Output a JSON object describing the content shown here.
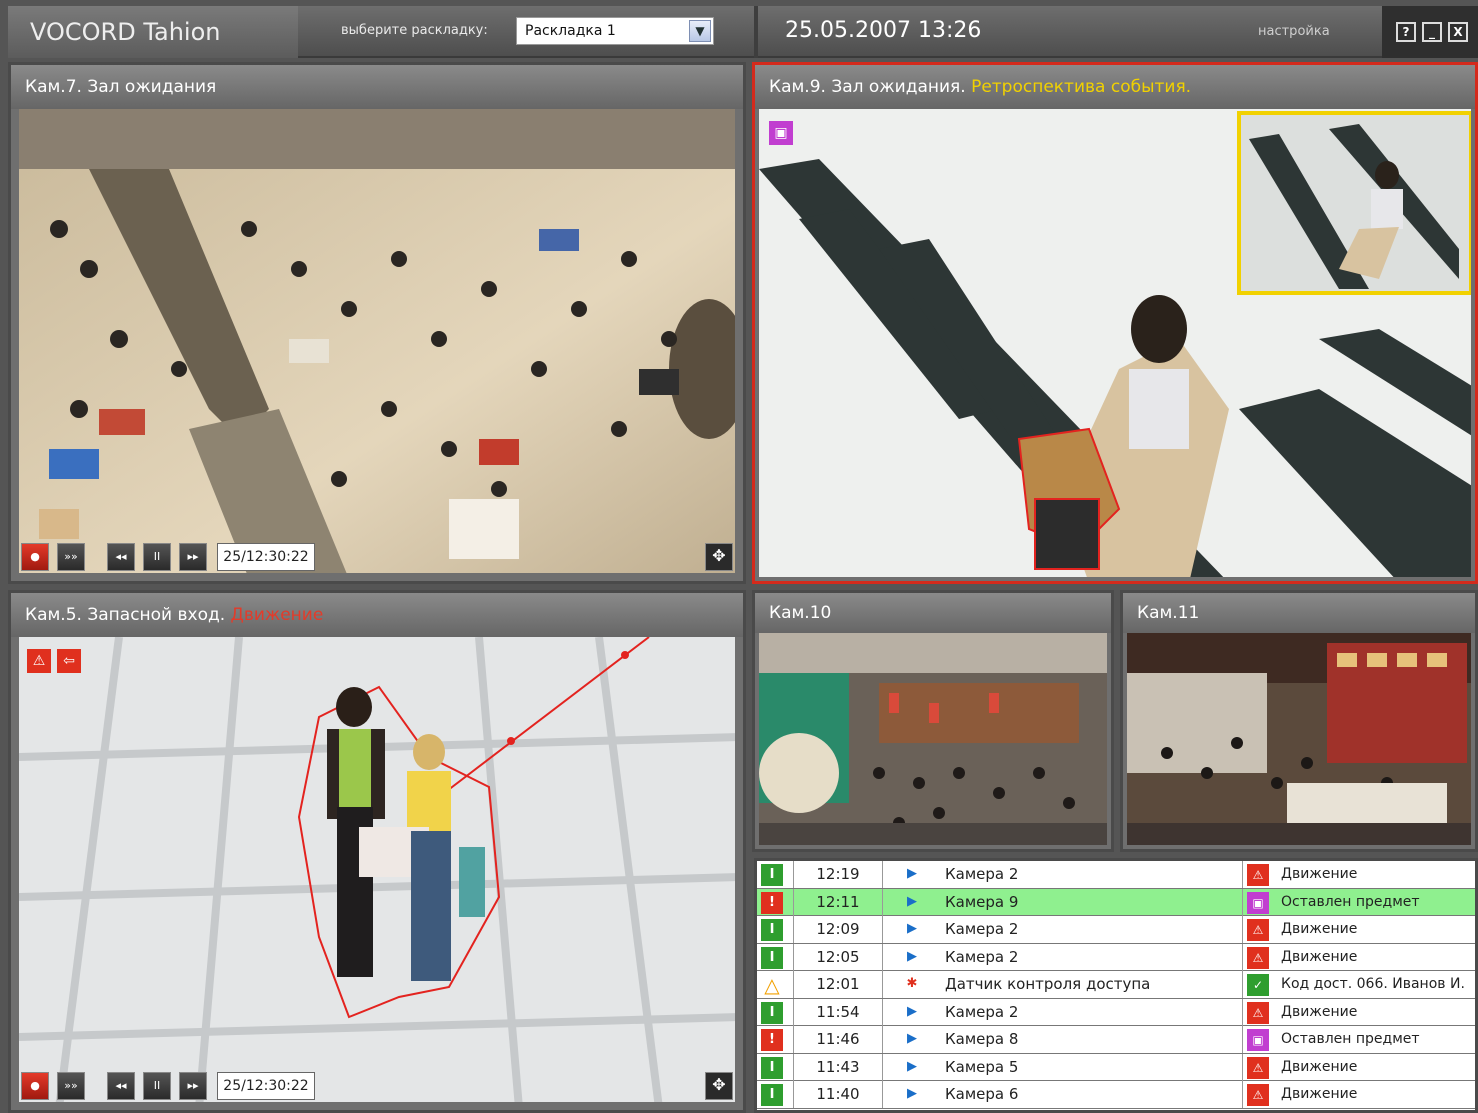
{
  "app": {
    "title": "VOCORD Tahion",
    "layout_label": "выберите раскладку:",
    "layout_value": "Раскладка 1",
    "datetime": "25.05.2007 13:26",
    "settings_label": "настройка",
    "window_buttons": [
      "?",
      "_",
      "X"
    ]
  },
  "panels": {
    "cam7": {
      "title": "Кам.7. Зал ожидания",
      "time": "25/12:30:22"
    },
    "cam9": {
      "title": "Кам.9. Зал ожидания.",
      "status": "Ретроспектива события."
    },
    "cam5": {
      "title": "Кам.5. Запасной вход.",
      "status": "Движение",
      "time": "25/12:30:22"
    },
    "cam10": {
      "title": "Кам.10"
    },
    "cam11": {
      "title": "Кам.11"
    }
  },
  "controls": {
    "fast": "»»",
    "rewind": "◂◂",
    "pause": "II",
    "forward": "▸▸",
    "expand": "✥"
  },
  "colors": {
    "alarm_red": "#d42a1c",
    "highlight_yellow": "#f1d100",
    "ok_green": "#2f9e2f",
    "row_highlight": "#8ff08f"
  },
  "event_log": [
    {
      "status": "info",
      "time": "12:19",
      "source": "Камера 2",
      "source_icon": "camera-icon",
      "event": "Движение",
      "event_type": "motion"
    },
    {
      "status": "alarm",
      "time": "12:11",
      "source": "Камера 9",
      "source_icon": "camera-icon",
      "event": "Оставлен предмет",
      "event_type": "left-item",
      "highlighted": true
    },
    {
      "status": "info",
      "time": "12:09",
      "source": "Камера 2",
      "source_icon": "camera-icon",
      "event": "Движение",
      "event_type": "motion"
    },
    {
      "status": "info",
      "time": "12:05",
      "source": "Камера 2",
      "source_icon": "camera-icon",
      "event": "Движение",
      "event_type": "motion"
    },
    {
      "status": "warning",
      "time": "12:01",
      "source": "Датчик контроля доступа",
      "source_icon": "sensor-icon",
      "event": "Код дост. 066. Иванов И.",
      "event_type": "access"
    },
    {
      "status": "info",
      "time": "11:54",
      "source": "Камера 2",
      "source_icon": "camera-icon",
      "event": "Движение",
      "event_type": "motion"
    },
    {
      "status": "alarm2",
      "time": "11:46",
      "source": "Камера 8",
      "source_icon": "camera-icon",
      "event": "Оставлен предмет",
      "event_type": "left-item"
    },
    {
      "status": "info",
      "time": "11:43",
      "source": "Камера 5",
      "source_icon": "camera-icon",
      "event": "Движение",
      "event_type": "motion"
    },
    {
      "status": "info",
      "time": "11:40",
      "source": "Камера 6",
      "source_icon": "camera-icon",
      "event": "Движение",
      "event_type": "motion"
    }
  ]
}
